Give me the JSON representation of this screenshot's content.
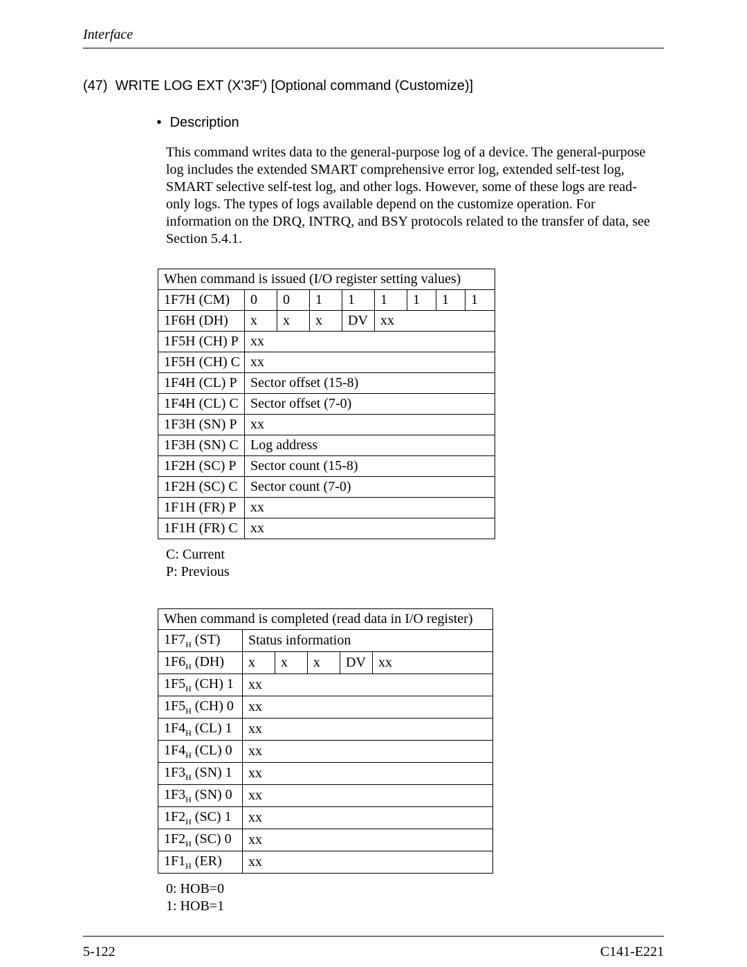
{
  "header": {
    "running": "Interface"
  },
  "section": {
    "num": "(47)",
    "title": "WRITE LOG EXT (X'3F') [Optional command (Customize)]"
  },
  "bullet": {
    "label": "Description"
  },
  "paragraph": "This command writes data to the general-purpose log of a device. The general-purpose log includes the extended SMART comprehensive error log, extended self-test log, SMART selective self-test log, and other logs. However, some of these logs are read-only logs. The types of logs available depend on the customize operation. For information on the DRQ, INTRQ, and BSY protocols related to the transfer of data, see Section 5.4.1.",
  "table1": {
    "title": "When command is issued (I/O register setting values)",
    "rows": {
      "cm": {
        "label": "1F7H (CM)",
        "bits": [
          "0",
          "0",
          "1",
          "1",
          "1",
          "1",
          "1",
          "1"
        ]
      },
      "dh": {
        "label": "1F6H (DH)",
        "b0": "x",
        "b1": "x",
        "b2": "x",
        "b3": "DV",
        "b4": "xx"
      },
      "chp": {
        "label": "1F5H (CH) P",
        "val": "xx"
      },
      "chc": {
        "label": "1F5H (CH) C",
        "val": "xx"
      },
      "clp": {
        "label": "1F4H (CL) P",
        "val": "Sector offset (15-8)"
      },
      "clc": {
        "label": "1F4H (CL) C",
        "val": "Sector offset (7-0)"
      },
      "snp": {
        "label": "1F3H (SN) P",
        "val": "xx"
      },
      "snc": {
        "label": "1F3H (SN) C",
        "val": "Log address"
      },
      "scp": {
        "label": "1F2H (SC) P",
        "val": "Sector count (15-8)"
      },
      "scc": {
        "label": "1F2H (SC) C",
        "val": "Sector count (7-0)"
      },
      "frp": {
        "label": "1F1H (FR) P",
        "val": "xx"
      },
      "frc": {
        "label": "1F1H (FR) C",
        "val": "xx"
      }
    }
  },
  "legend1": {
    "c": "C:  Current",
    "p": "P:  Previous"
  },
  "table2": {
    "title": "When command is completed (read data in I/O register)",
    "rows": {
      "st": {
        "label_pre": "1F7",
        "label_post": " (ST)",
        "val": "Status information"
      },
      "dh": {
        "label_pre": "1F6",
        "label_post": " (DH)",
        "b0": "x",
        "b1": "x",
        "b2": "x",
        "b3": "DV",
        "b4": "xx"
      },
      "ch1": {
        "label_pre": "1F5",
        "label_post": " (CH) 1",
        "val": "xx"
      },
      "ch0": {
        "label_pre": "1F5",
        "label_post": " (CH) 0",
        "val": "xx"
      },
      "cl1": {
        "label_pre": "1F4",
        "label_post": " (CL) 1",
        "val": "xx"
      },
      "cl0": {
        "label_pre": "1F4",
        "label_post": " (CL) 0",
        "val": "xx"
      },
      "sn1": {
        "label_pre": "1F3",
        "label_post": " (SN) 1",
        "val": "xx"
      },
      "sn0": {
        "label_pre": "1F3",
        "label_post": " (SN) 0",
        "val": "xx"
      },
      "sc1": {
        "label_pre": "1F2",
        "label_post": " (SC) 1",
        "val": "xx"
      },
      "sc0": {
        "label_pre": "1F2",
        "label_post": " (SC) 0",
        "val": "xx"
      },
      "er": {
        "label_pre": "1F1",
        "label_post": " (ER)",
        "val": "xx"
      }
    }
  },
  "legend2": {
    "a": "0:  HOB=0",
    "b": "1:  HOB=1"
  },
  "footer": {
    "left": "5-122",
    "right": "C141-E221"
  }
}
